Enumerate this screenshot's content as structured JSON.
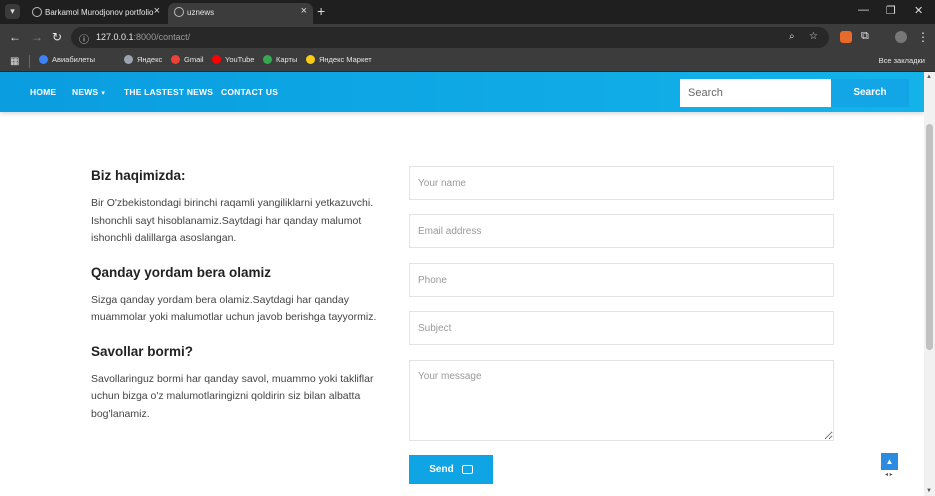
{
  "browser": {
    "tabs": [
      {
        "title": "Barkamol Murodjonov portfolio"
      },
      {
        "title": "uznews"
      }
    ],
    "url_host": "127.0.0.1",
    "url_rest": ":8000/contact/",
    "bookmarks": [
      {
        "label": "Авиабилеты",
        "color": "#3b82f6"
      },
      {
        "label": "Яндекс",
        "color": "#9ca3af"
      },
      {
        "label": "Gmail",
        "color": "#ea4335"
      },
      {
        "label": "YouTube",
        "color": "#ff0000"
      },
      {
        "label": "Карты",
        "color": "#34a853"
      },
      {
        "label": "Яндекс Маркет",
        "color": "#facc15"
      }
    ],
    "all_bookmarks": "Все закладки"
  },
  "nav": {
    "home": "HOME",
    "news": "NEWS",
    "latest": "THE LASTEST NEWS",
    "contact": "CONTACT US"
  },
  "search": {
    "placeholder": "Search",
    "button": "Search"
  },
  "about": {
    "heading1": "Biz haqimizda:",
    "text1": "Bir O'zbekistondagi birinchi raqamli yangiliklarni yetkazuvchi. Ishonchli sayt hisoblanamiz.Saytdagi har qanday malumot ishonchli dalillarga asoslangan.",
    "heading2": "Qanday yordam bera olamiz",
    "text2": "Sizga qanday yordam bera olamiz.Saytdagi har qanday muammolar yoki malumotlar uchun javob berishga tayyormiz.",
    "heading3": "Savollar bormi?",
    "text3": "Savollaringuz bormi har qanday savol, muammo yoki takliflar uchun bizga o'z malumotlaringizni qoldirin siz bilan albatta bog'lanamiz."
  },
  "form": {
    "name_placeholder": "Your name",
    "email_placeholder": "Email address",
    "phone_placeholder": "Phone",
    "subject_placeholder": "Subject",
    "message_placeholder": "Your message",
    "send": "Send"
  },
  "colors": {
    "header": "#0fa4e4",
    "accent": "#0fa4e4"
  }
}
